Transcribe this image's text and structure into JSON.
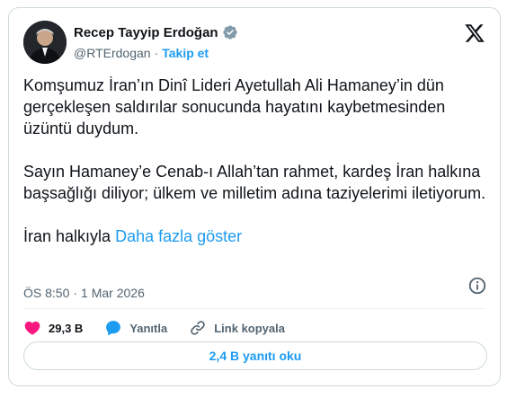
{
  "author": {
    "display_name": "Recep Tayyip Erdoğan",
    "handle": "@RTErdogan",
    "separator": "·",
    "follow_label": "Takip et"
  },
  "tweet": {
    "paragraphs": [
      "Komşumuz İran’ın Dinî Lideri Ayetullah Ali Hamaney’in dün gerçekleşen saldırılar sonucunda hayatını kaybetmesinden üzüntü duydum.",
      "Sayın Hamaney’e Cenab-ı Allah’tan rahmet, kardeş İran halkına başsağlığı diliyor; ülkem ve milletim adına taziyelerimi iletiyorum."
    ],
    "truncated_text": "İran halkıyla",
    "show_more_label": "Daha fazla göster",
    "time": "ÖS 8:50",
    "date_separator": "·",
    "date": "1 Mar 2026"
  },
  "actions": {
    "likes_count": "29,3 B",
    "reply_label": "Yanıtla",
    "copy_link_label": "Link kopyala"
  },
  "replies_button_label": "2,4 B yanıtı oku",
  "colors": {
    "accent": "#1d9bf0",
    "like": "#f91880",
    "text": "#0f1419",
    "muted": "#536471",
    "border": "#cfd9de"
  },
  "icons": [
    "x-logo-icon",
    "verified-badge-icon",
    "info-icon",
    "heart-icon",
    "reply-bubble-icon",
    "link-icon"
  ]
}
